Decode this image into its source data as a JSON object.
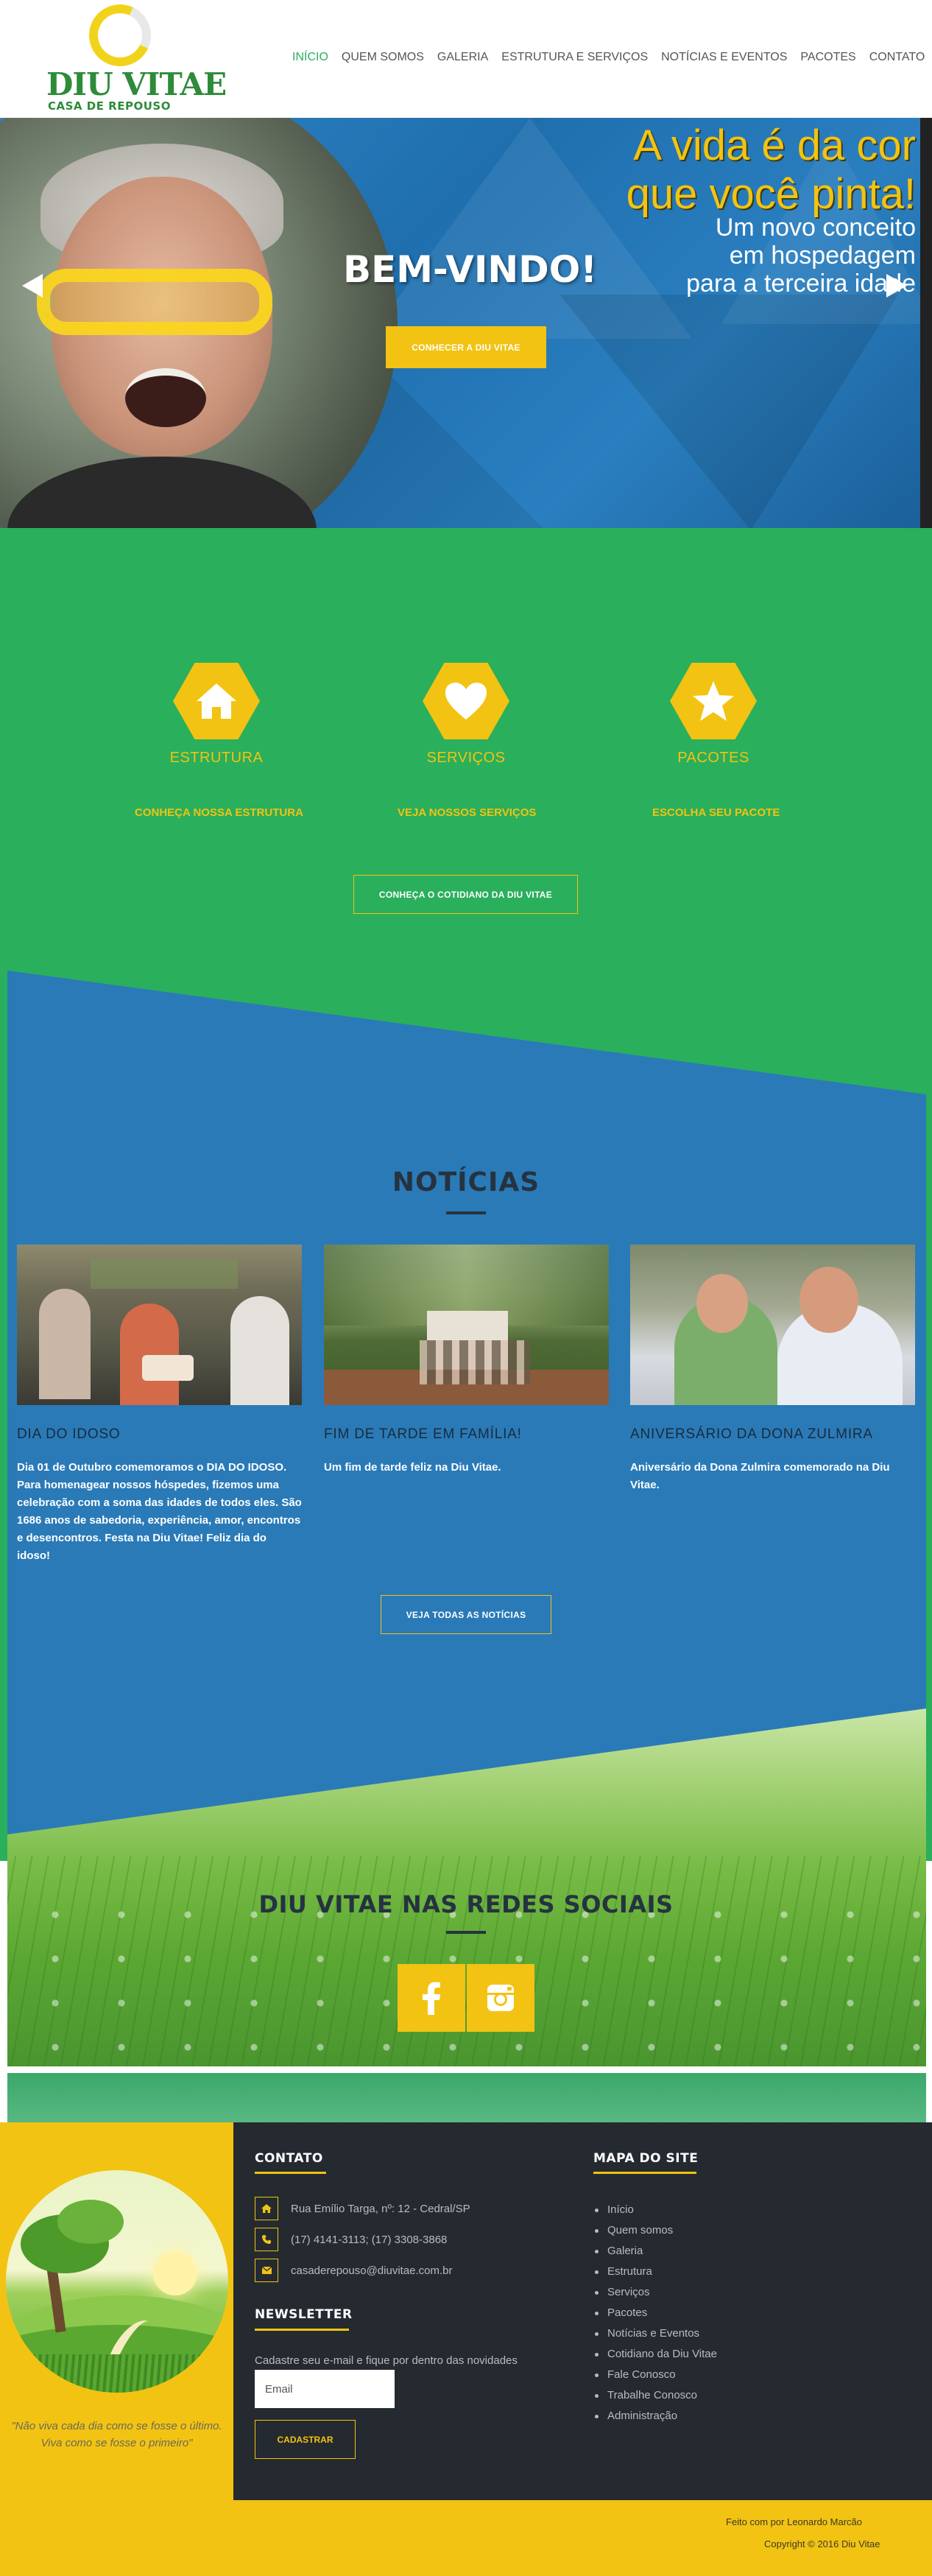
{
  "header": {
    "logo_title": "DIU VITAE",
    "logo_subtitle": "CASA DE REPOUSO",
    "nav": [
      {
        "label": "INÍCIO",
        "active": true
      },
      {
        "label": "QUEM SOMOS"
      },
      {
        "label": "GALERIA"
      },
      {
        "label": "ESTRUTURA E SERVIÇOS"
      },
      {
        "label": "NOTÍCIAS E EVENTOS"
      },
      {
        "label": "PACOTES"
      },
      {
        "label": "CONTATO"
      }
    ]
  },
  "hero": {
    "headline_line1": "A vida é da cor",
    "headline_line2": "que você pinta!",
    "sub_line1": "Um novo conceito",
    "sub_line2": "em hospedagem",
    "sub_line3": "para a terceira idade",
    "welcome": "BEM-VINDO!",
    "cta": "CONHECER A DIU VITAE",
    "prev_icon": "arrow-left-icon",
    "next_icon": "arrow-right-icon"
  },
  "features": [
    {
      "icon": "home-icon",
      "title": "ESTRUTURA",
      "link": "CONHEÇA NOSSA ESTRUTURA"
    },
    {
      "icon": "heart-icon",
      "title": "SERVIÇOS",
      "link": "VEJA NOSSOS SERVIÇOS"
    },
    {
      "icon": "star-icon",
      "title": "PACOTES",
      "link": "ESCOLHA SEU PACOTE"
    }
  ],
  "cotidiano_button": "CONHEÇA O COTIDIANO DA DIU VITAE",
  "news": {
    "title": "NOTÍCIAS",
    "items": [
      {
        "heading": "DIA DO IDOSO",
        "text": "Dia 01 de Outubro comemoramos o DIA DO IDOSO. Para homenagear nossos hóspedes, fizemos uma celebração com a soma das idades de todos eles. São 1686 anos de sabedoria, experiência, amor, encontros e desencontros. Festa na Diu Vitae! Feliz dia do idoso!"
      },
      {
        "heading": "FIM DE TARDE EM FAMÍLIA!",
        "text": "Um fim de tarde feliz na Diu Vitae."
      },
      {
        "heading": "ANIVERSÁRIO DA DONA ZULMIRA",
        "text": "Aniversário da Dona Zulmira comemorado na Diu Vitae."
      }
    ],
    "all_button": "VEJA TODAS AS NOTÍCIAS"
  },
  "social": {
    "title": "DIU VITAE NAS REDES SOCIAIS",
    "buttons": [
      {
        "icon": "facebook-icon"
      },
      {
        "icon": "instagram-icon"
      }
    ]
  },
  "footer": {
    "quote_line1": "\"Não viva cada dia como se fosse o último.",
    "quote_line2": "Viva como se fosse o primeiro\"",
    "contact_heading": "CONTATO",
    "contact": [
      {
        "icon": "home-icon",
        "text": "Rua Emílio Targa, nº: 12 - Cedral/SP"
      },
      {
        "icon": "phone-icon",
        "text": "(17) 4141-3113; (17) 3308-3868"
      },
      {
        "icon": "envelope-icon",
        "text": "casaderepouso@diuvitae.com.br"
      }
    ],
    "newsletter_heading": "NEWSLETTER",
    "newsletter_text": "Cadastre seu e-mail e fique por dentro das novidades",
    "newsletter_placeholder": "Email",
    "newsletter_button": "CADASTRAR",
    "sitemap_heading": "MAPA DO SITE",
    "sitemap": [
      "Início",
      "Quem somos",
      "Galeria",
      "Estrutura",
      "Serviços",
      "Pacotes",
      "Notícias e Eventos",
      "Cotidiano da Diu Vitae",
      "Fale Conosco",
      "Trabalhe Conosco",
      "Administração"
    ],
    "credits": "Feito com     por Leonardo Marcão",
    "copyright": "Copyright © 2016 Diu Vitae"
  },
  "colors": {
    "brand_green": "#2aaf5c",
    "brand_yellow": "#f2c312",
    "brand_blue": "#2a7ab8",
    "footer_dark": "#252a31"
  }
}
